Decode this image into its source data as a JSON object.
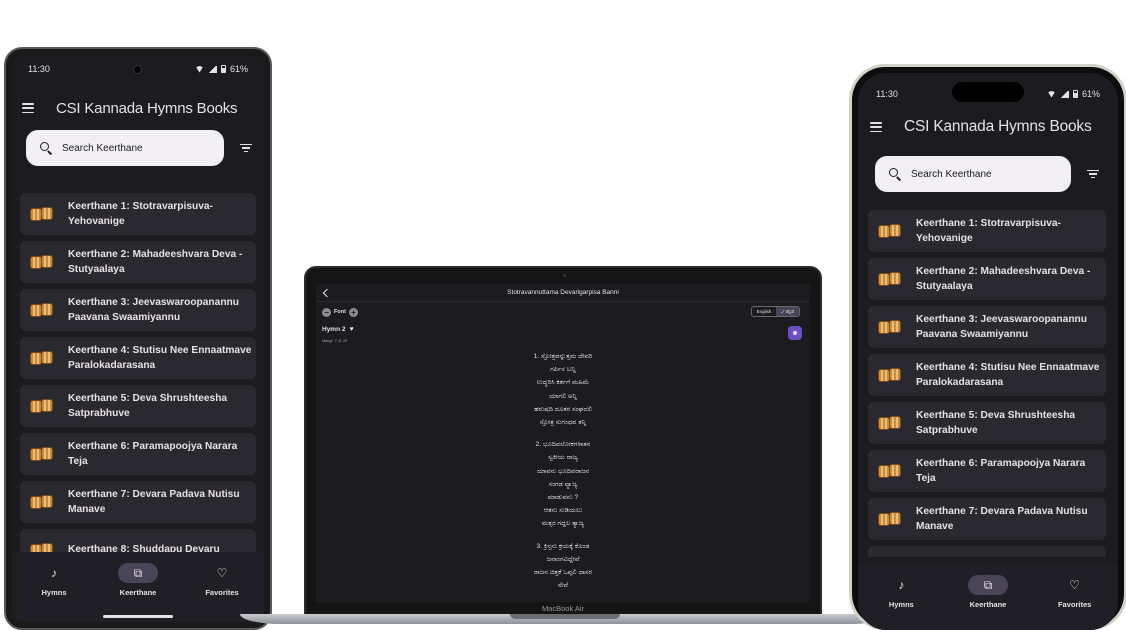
{
  "status": {
    "time": "11:30",
    "battery": "61%"
  },
  "app": {
    "title": "CSI Kannada Hymns Books"
  },
  "search": {
    "placeholder": "Search Keerthane"
  },
  "list_items_left": [
    {
      "line1": "Keerthane 1: Stotravarpisuva-",
      "line2": "Yehovanige"
    },
    {
      "line1": "Keerthane 2: Mahadeeshvara Deva -",
      "line2": "Stutyaalaya"
    },
    {
      "line1": "Keerthane 3: Jeevaswaroopanannu",
      "line2": "Paavana Swaamiyannu"
    },
    {
      "line1": "Keerthane 4: Stutisu Nee Ennaatmave",
      "line2": "Paralokadarasana"
    },
    {
      "line1": "Keerthane 5: Deva Shrushteesha",
      "line2": "Satprabhuve"
    },
    {
      "line1": "Keerthane 6: Paramapoojya Narara",
      "line2": "Teja"
    },
    {
      "line1": "Keerthane 7: Devara Padava Nutisu",
      "line2": "Manave"
    },
    {
      "line1": "Keerthane 8: Shuddapu Devaru",
      "line2": ""
    }
  ],
  "nav": {
    "hymns": "Hymns",
    "keerthane": "Keerthane",
    "favorites": "Favorites"
  },
  "icons": {
    "menu": "menu-icon",
    "search": "search-icon",
    "filter": "filter-icon",
    "list_item": "drum-icon",
    "nav_hymns": "music-note-icon",
    "nav_keerthane": "library-icon",
    "nav_favorites": "heart-icon"
  },
  "colors": {
    "background": "#1c1b1f",
    "surface": "#2b2930",
    "nav_active": "#4a4458",
    "accent": "#6c4fc9"
  },
  "laptop": {
    "brand": "MacBook Air",
    "title": "Stotravannuttama Devarigarpisa Banni",
    "font_label": "Font",
    "lang_english": "English",
    "lang_kannada": "✓ ಕನ್ನಡ",
    "hymn_title": "Hymn 2",
    "meter": "Mangi. 7. 8. 10",
    "stanzas": [
      [
        "1. ಸ್ತೋತ್ರವನ್ನುತ್ತಮ ದೇವರಿ",
        "ಗರ್ಪಿಸ ಬನ್ನಿ",
        "ಉದ್ಧರಿಸಿ ಕರ್ತಗೆ ಮಹಿಮೆ",
        "ಯಾಗಲಿ ಅನ್ನಿ",
        "ಹರುಷದಿ ದೂತರ ಸಂಘದಲಿ",
        "ಸ್ತೋತ್ರ ಸುಗಂಧವ ತನ್ನಿ"
      ],
      [
        "2. ಭೂದಿವಲೋಕಗಳಾತನ",
        "ಸ್ವಕೀಯ ರಾಜ್ಯ",
        "ಯಾವನು ಭೂದಿವರಾಜನ",
        "ಸಂಗಡ ವ್ಯಾಜ್ಯ",
        "ಮಾಡುವನು ?",
        "ಆತನು ಸುಡಿಯಲು",
        "ಮತ್ಸರ ಗದ್ದಲ ತ್ಯಾಜ್ಯ"
      ],
      [
        "3. ಕ್ರಿಸ್ತನು ಕ್ರಯಕ್ಕೆ ಕೊಂಡ",
        "ಜನಾಂಗವಿದ್ದೇವೆ",
        "ರಾಜನ ಚಿತ್ತಕೆ ಒಪ್ಪಲಿ ದಾಸರ",
        "ಸೇವೆ"
      ]
    ]
  }
}
